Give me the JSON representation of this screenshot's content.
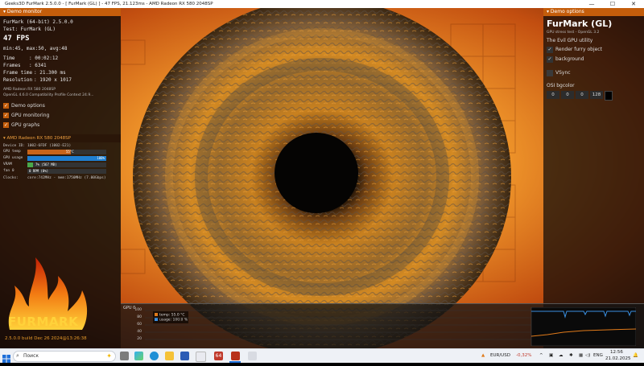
{
  "window": {
    "title": "Geeks3D FurMark 2.5.0.0 - [ FurMark (GL) ] - 47 FPS, 21.123ms - AMD Radeon RX 580 2048SP",
    "min_glyph": "—",
    "max_glyph": "☐",
    "close_glyph": "✕"
  },
  "demo_monitor": {
    "header": "Demo monitor",
    "app_line": "FurMark (64-bit) 2.5.0.0",
    "test_line": "Test: FurMark (GL)",
    "fps": "47 FPS",
    "minmax": "min:45, max:50, avg:48",
    "time_label": "Time",
    "time_value": ": 00:02:12",
    "frames_label": "Frames",
    "frames_value": ": 6341",
    "frametime_label": "Frame time",
    "frametime_value": ": 21.300 ms",
    "resolution_label": "Resolution",
    "resolution_value": ": 1920 x 1017",
    "renderer": "AMD Radeon RX 580 2048SP",
    "opengl": "OpenGL 4.6.0 Compatibility Profile Context 24.9...",
    "options": [
      {
        "label": "Demo options",
        "checked": true
      },
      {
        "label": "GPU monitoring",
        "checked": true
      },
      {
        "label": "GPU graphs",
        "checked": true
      }
    ]
  },
  "gpu_section": {
    "header": "AMD Radeon RX 580 2048SP",
    "device_label": "Device ID:",
    "device_value": "1002-6FDF (1002-E21)",
    "gpu_temp_label": "GPU temp",
    "gpu_temp_value": "55°C",
    "gpu_temp_fraction": 0.55,
    "gpu_usage_label": "GPU usage",
    "gpu_usage_value": "100%",
    "gpu_usage_fraction": 1.0,
    "vram_label": "VRAM",
    "vram_value": "7% (567 MB)",
    "vram_fraction": 0.07,
    "fan_label": "fan 0",
    "fan_value": "0 RPM (0%)",
    "fan_fraction": 0.0,
    "clocks_label": "Clocks:",
    "clocks_value": "core:742MHz - mem:1750MHz (7.00Gbps)"
  },
  "demo_options": {
    "header": "Demo options",
    "title": "FurMark (GL)",
    "subtitle": "GPU stress test - OpenGL 3.2",
    "tagline": "The Evil GPU utility",
    "checkboxes": [
      {
        "label": "Render furry object",
        "checked": true
      },
      {
        "label": "background",
        "checked": true
      },
      {
        "label": "VSync",
        "checked": false
      }
    ],
    "bgcolor_label": "OSI bgcolor",
    "bgcolor_values": [
      "0",
      "0",
      "0",
      "128"
    ]
  },
  "logo": {
    "wordmark": "FURMARK",
    "build": "2.5.0.0 build Dec 26 2024@13:26:38"
  },
  "graph": {
    "label": "GPU 0",
    "axis_ticks": [
      "100",
      "80",
      "60",
      "40",
      "20"
    ],
    "legend": [
      {
        "label": "temp: 55.0 °C",
        "color": "#e07a1a"
      },
      {
        "label": "usage: 100.0 %",
        "color": "#3a8fe0"
      }
    ]
  },
  "taskbar": {
    "search_placeholder": "Поиск",
    "pinned_badge": "64",
    "currency_pair": "EUR/USD",
    "currency_change": "-0,32%",
    "language": "ENG",
    "time": "12:56",
    "date": "21.02.2025"
  },
  "colors": {
    "accent": "#c45d0b",
    "usage_bar": "#1f7fd1",
    "temp_bar": "#c8641a",
    "vram_bar": "#6a6a6a"
  }
}
